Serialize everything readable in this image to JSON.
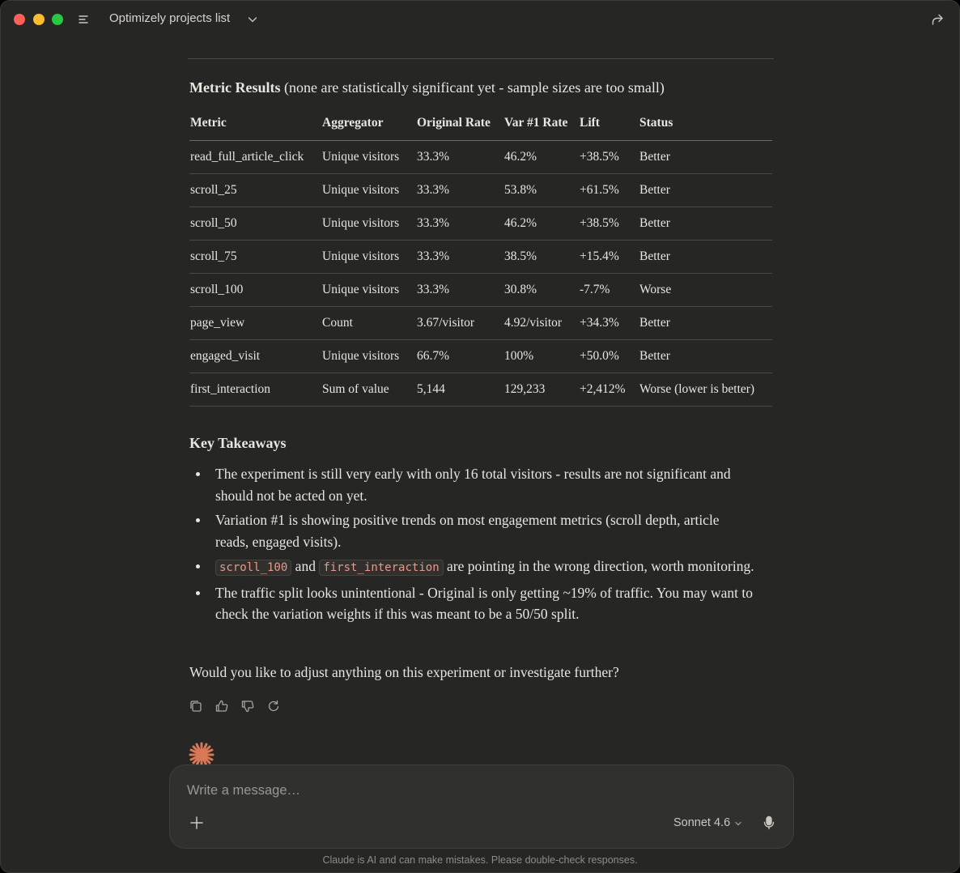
{
  "window": {
    "title": "Optimizely projects list"
  },
  "icons": {
    "menu": "menu-lines-icon",
    "title_chevron": "chevron-down-icon",
    "share": "share-arrow-icon",
    "copy": "copy-icon",
    "thumbs_up": "thumbs-up-icon",
    "thumbs_down": "thumbs-down-icon",
    "retry": "retry-icon",
    "assistant": "claude-spark-icon",
    "attach": "plus-icon",
    "model_chevron": "chevron-down-icon",
    "mic": "microphone-icon"
  },
  "colors": {
    "background": "#262624",
    "accent": "#d97757",
    "code_text": "#e59a8c"
  },
  "message": {
    "heading_bold": "Metric Results",
    "heading_rest": " (none are statistically significant yet - sample sizes are too small)",
    "table": {
      "headers": [
        "Metric",
        "Aggregator",
        "Original Rate",
        "Var #1 Rate",
        "Lift",
        "Status"
      ],
      "rows": [
        [
          "read_full_article_click",
          "Unique visitors",
          "33.3%",
          "46.2%",
          "+38.5%",
          "Better"
        ],
        [
          "scroll_25",
          "Unique visitors",
          "33.3%",
          "53.8%",
          "+61.5%",
          "Better"
        ],
        [
          "scroll_50",
          "Unique visitors",
          "33.3%",
          "46.2%",
          "+38.5%",
          "Better"
        ],
        [
          "scroll_75",
          "Unique visitors",
          "33.3%",
          "38.5%",
          "+15.4%",
          "Better"
        ],
        [
          "scroll_100",
          "Unique visitors",
          "33.3%",
          "30.8%",
          "-7.7%",
          "Worse"
        ],
        [
          "page_view",
          "Count",
          "3.67/visitor",
          "4.92/visitor",
          "+34.3%",
          "Better"
        ],
        [
          "engaged_visit",
          "Unique visitors",
          "66.7%",
          "100%",
          "+50.0%",
          "Better"
        ],
        [
          "first_interaction",
          "Sum of value",
          "5,144",
          "129,233",
          "+2,412%",
          "Worse (lower is better)"
        ]
      ]
    },
    "takeaways_title": "Key Takeaways",
    "takeaways": {
      "b1": "The experiment is still very early with only 16 total visitors - results are not significant and should not be acted on yet.",
      "b2": "Variation #1 is showing positive trends on most engagement metrics (scroll depth, article reads, engaged visits).",
      "b3_code1": "scroll_100",
      "b3_and": " and ",
      "b3_code2": "first_interaction",
      "b3_rest": " are pointing in the wrong direction, worth monitoring.",
      "b4": "The traffic split looks unintentional - Original is only getting ~19% of traffic. You may want to check the variation weights if this was meant to be a 50/50 split."
    },
    "question": "Would you like to adjust anything on this experiment or investigate further?"
  },
  "composer": {
    "placeholder": "Write a message…",
    "value": "",
    "model": "Sonnet 4.6"
  },
  "disclaimer": "Claude is AI and can make mistakes. Please double-check responses."
}
